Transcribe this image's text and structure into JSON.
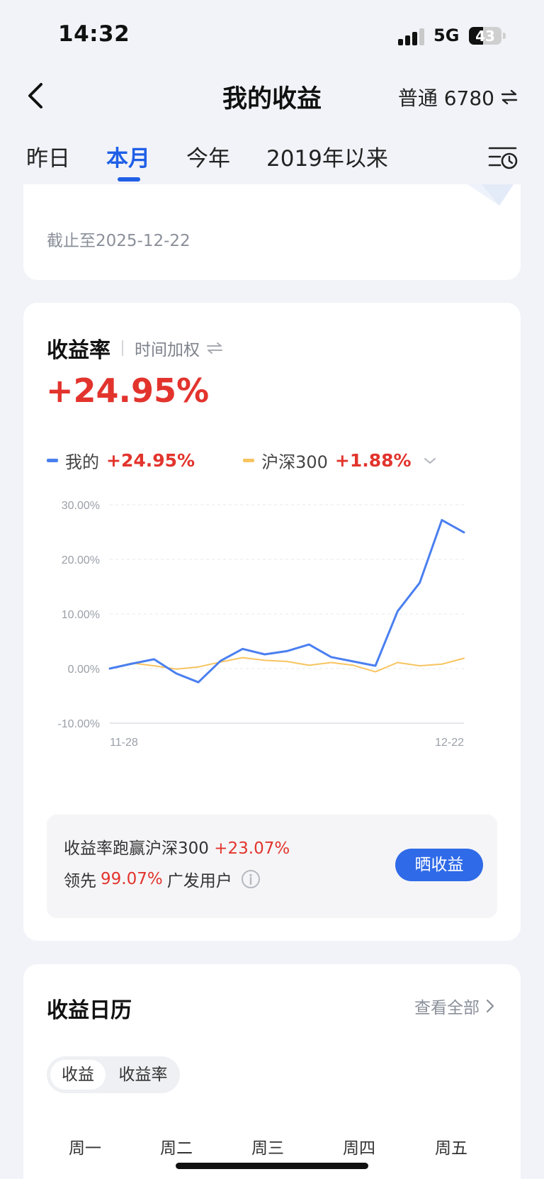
{
  "status": {
    "time": "14:32",
    "network": "5G",
    "battery": "43",
    "battery_level_percent": 43
  },
  "nav": {
    "title": "我的收益",
    "account": "普通 6780"
  },
  "tabs": [
    {
      "label": "昨日",
      "active": false
    },
    {
      "label": "本月",
      "active": true
    },
    {
      "label": "今年",
      "active": false
    },
    {
      "label": "2019年以来",
      "active": false
    }
  ],
  "summary": {
    "as_of": "截止至2025-12-22"
  },
  "rate": {
    "title": "收益率",
    "mode": "时间加权",
    "value": "+24.95%",
    "legend": [
      {
        "name": "我的",
        "value": "+24.95%",
        "color": "#4a7ff0"
      },
      {
        "name": "沪深300",
        "value": "+1.88%",
        "color": "#f7c460"
      }
    ]
  },
  "chart_data": {
    "type": "line",
    "title": "",
    "xlabel": "",
    "ylabel": "",
    "x_ticks": [
      "11-28",
      "12-22"
    ],
    "y_ticks": [
      "30.00%",
      "20.00%",
      "10.00%",
      "0.00%",
      "-10.00%"
    ],
    "ylim": [
      -10,
      30
    ],
    "grid": true,
    "series": [
      {
        "name": "我的",
        "color": "#4a7ff0",
        "values": [
          0.0,
          0.9,
          1.7,
          -0.9,
          -2.5,
          1.4,
          3.6,
          2.6,
          3.2,
          4.4,
          2.1,
          1.3,
          0.5,
          10.5,
          15.7,
          27.2,
          24.95
        ]
      },
      {
        "name": "沪深300",
        "color": "#f7c460",
        "values": [
          0.0,
          1.0,
          0.5,
          -0.1,
          0.3,
          1.2,
          2.0,
          1.5,
          1.3,
          0.6,
          1.1,
          0.6,
          -0.6,
          1.1,
          0.5,
          0.8,
          1.88
        ]
      }
    ]
  },
  "compare": {
    "line1_text": "收益率跑赢沪深300",
    "line1_value": "+23.07%",
    "line2_prefix": "领先",
    "line2_value": "99.07%",
    "line2_suffix": "广发用户",
    "share_button": "晒收益"
  },
  "calendar": {
    "title": "收益日历",
    "view_all": "查看全部",
    "segments": [
      "收益",
      "收益率"
    ],
    "weekdays": [
      "周一",
      "周二",
      "周三",
      "周四",
      "周五"
    ]
  }
}
